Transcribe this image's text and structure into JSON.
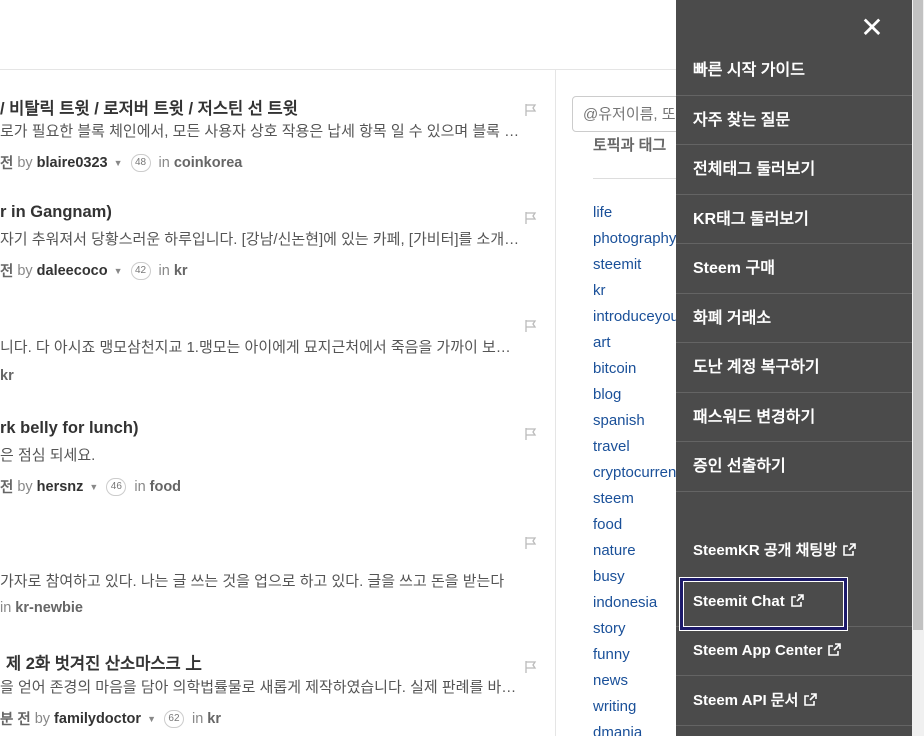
{
  "search": {
    "placeholder": "@유저이름, 또"
  },
  "sidebar": {
    "topic_heading": "토픽과 태그",
    "tags": [
      "life",
      "photography",
      "steemit",
      "kr",
      "introduceyourself",
      "art",
      "bitcoin",
      "blog",
      "spanish",
      "travel",
      "cryptocurrency",
      "steem",
      "food",
      "nature",
      "busy",
      "indonesia",
      "story",
      "funny",
      "news",
      "writing",
      "dmania"
    ]
  },
  "posts": [
    {
      "title": "/ 비탈릭 트윗 / 로저버 트윗 / 저스틴 선 트윗",
      "body": "로가 필요한 블록 체인에서, 모든 사용자 상호 작용은 납세 항목 일 수 있으며 블록 체인은 엄청난 비용이 듭니다",
      "time": "전",
      "by": "by",
      "author": "blaire0323",
      "rep": "48",
      "in": "in",
      "category": "coinkorea"
    },
    {
      "title": "r in Gangnam)",
      "body": "자기 추워져서 당황스러운 하루입니다. [강남/신논현]에 있는 카페, [가비터]를 소개합니다",
      "time": "전",
      "by": "by",
      "author": "daleecoco",
      "rep": "42",
      "in": "in",
      "category": "kr"
    },
    {
      "title": "",
      "body": "니다. 다 아시죠 맹모삼천지교 1.맹모는 아이에게 묘지근처에서 죽음을 가까이 보게 했습니다",
      "time": "",
      "by": "",
      "author": "",
      "rep": "",
      "in": "",
      "category": "kr"
    },
    {
      "title": "rk belly for lunch)",
      "body": "은 점심 되세요.",
      "time": "전",
      "by": "by",
      "author": "hersnz",
      "rep": "46",
      "in": "in",
      "category": "food"
    },
    {
      "title": "",
      "body": "가자로 참여하고 있다. 나는 글 쓰는 것을 업으로 하고 있다. 글을 쓰고 돈을 받는다",
      "time": "",
      "by": "",
      "author": "",
      "rep": "",
      "in": "in",
      "category": "kr-newbie"
    },
    {
      "title": "제 2화 벗겨진 산소마스크 上",
      "body": "을 얻어 존경의 마음을 담아 의학법률물로 새롭게 제작하였습니다. 실제 판례를 바탕으로",
      "time": "분 전",
      "by": "by",
      "author": "familydoctor",
      "rep": "62",
      "in": "in",
      "category": "kr"
    }
  ],
  "menu": {
    "close": "✕",
    "items": [
      "빠른 시작 가이드",
      "자주 찾는 질문",
      "전체태그 둘러보기",
      "KR태그 둘러보기",
      "Steem 구매",
      "화폐 거래소",
      "도난 계정 복구하기",
      "패스워드 변경하기",
      "증인 선출하기"
    ],
    "external": [
      "SteemKR 공개 채팅방",
      "Steemit Chat",
      "Steem App Center",
      "Steem API 문서"
    ]
  }
}
